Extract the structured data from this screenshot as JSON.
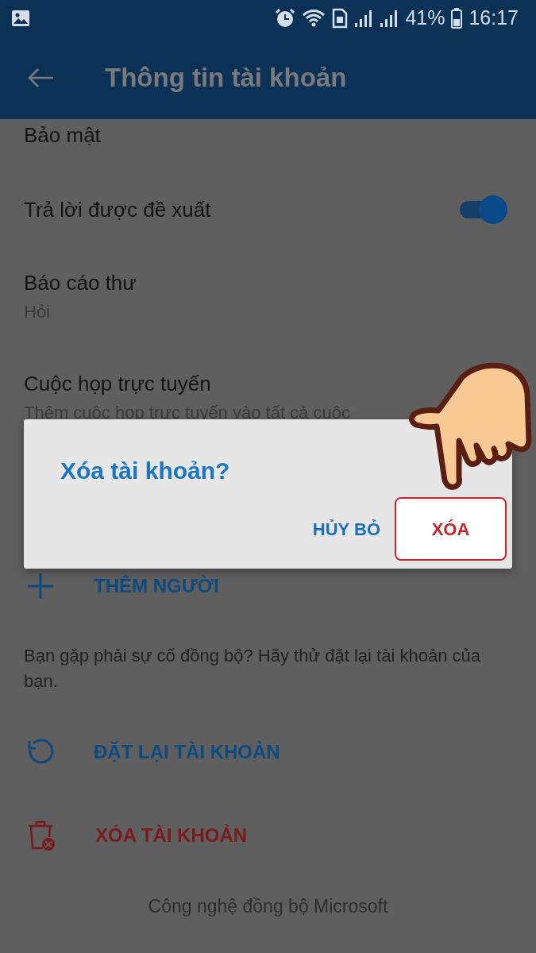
{
  "status_bar": {
    "battery_percent": "41%",
    "time": "16:17"
  },
  "app_bar": {
    "title": "Thông tin tài khoản"
  },
  "settings": [
    {
      "kind": "title",
      "title": "Bảo mật"
    },
    {
      "kind": "toggle",
      "title": "Trả lời được đề xuất",
      "on": true
    },
    {
      "kind": "value",
      "title": "Báo cáo thư",
      "value": "Hỏi"
    },
    {
      "kind": "value",
      "title": "Cuộc họp trực tuyến",
      "value": "Thêm cuộc họp trực tuyến vào tất cả cuộc"
    }
  ],
  "add_person": {
    "label": "THÊM NGƯỜI"
  },
  "sync_note": "Bạn gặp phải sự cố đồng bộ? Hãy thử đặt lại tài khoản của bạn.",
  "actions": [
    {
      "kind": "reset",
      "label": "ĐẶT LẠI TÀI KHOẢN"
    },
    {
      "kind": "delete",
      "label": "XÓA TÀI KHOẢN"
    }
  ],
  "footer": "Công nghệ đồng bộ Microsoft",
  "dialog": {
    "title": "Xóa tài khoản?",
    "buttons": [
      {
        "kind": "cancel",
        "label": "HỦY BỎ",
        "highlighted": false
      },
      {
        "kind": "confirm",
        "label": "XÓA",
        "highlighted": true
      }
    ]
  }
}
